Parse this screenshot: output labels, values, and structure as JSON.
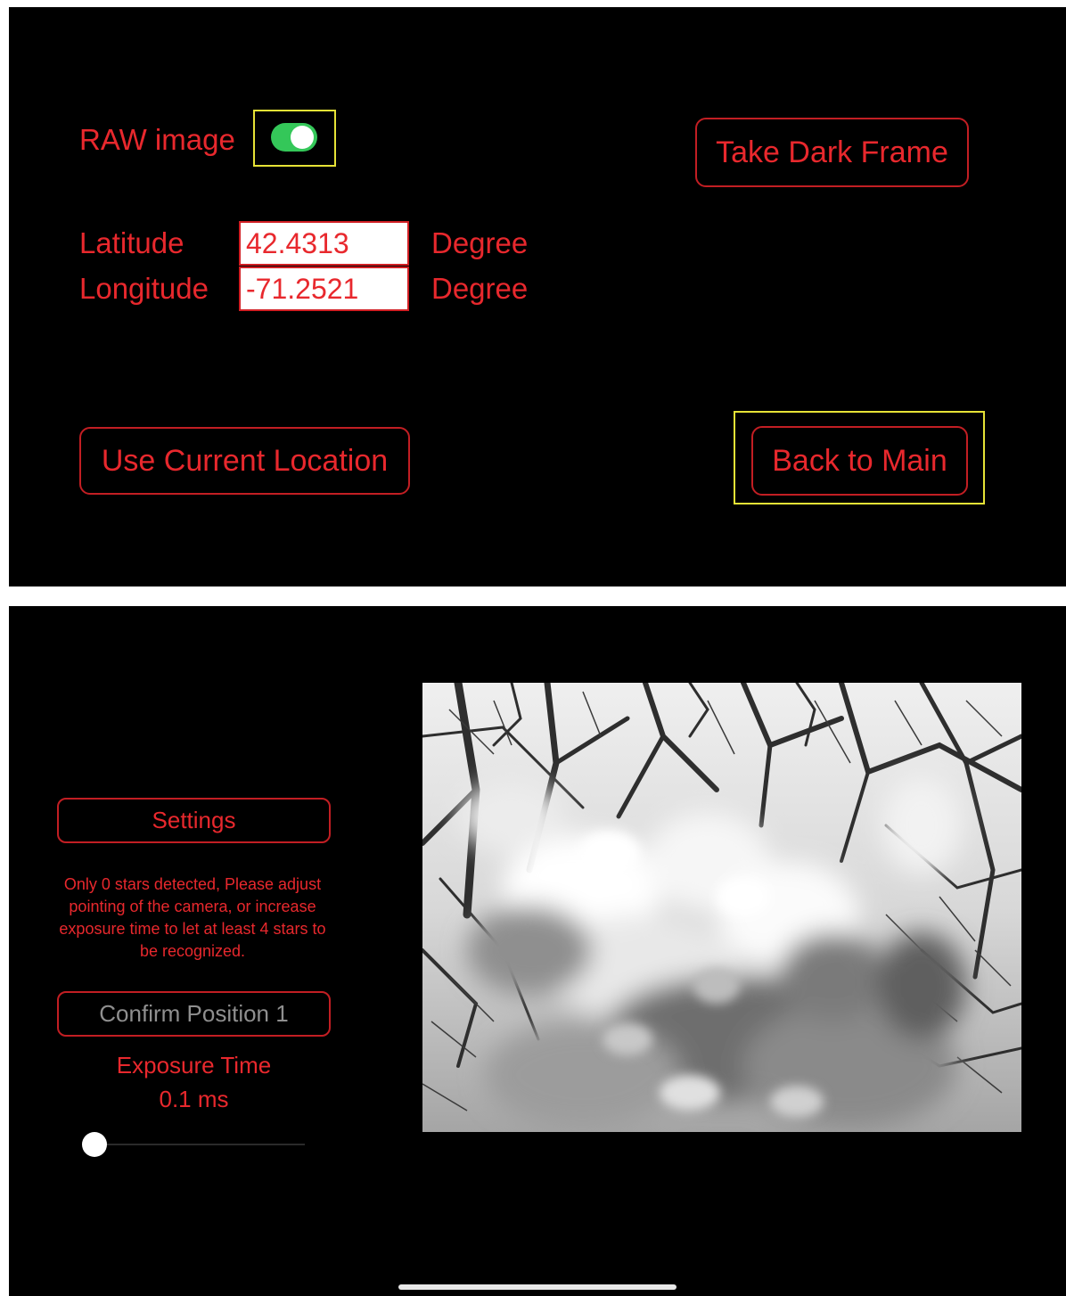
{
  "settings_screen": {
    "raw_image_label": "RAW image",
    "raw_image_enabled": true,
    "take_dark_frame_label": "Take Dark Frame",
    "latitude_label": "Latitude",
    "latitude_value": "42.4313",
    "latitude_unit": "Degree",
    "longitude_label": "Longitude",
    "longitude_value": "-71.2521",
    "longitude_unit": "Degree",
    "use_current_location_label": "Use Current Location",
    "back_to_main_label": "Back to Main"
  },
  "main_screen": {
    "settings_label": "Settings",
    "status_message": "Only 0  stars detected, Please adjust pointing of the camera, or increase exposure time to let at least 4 stars to be recognized.",
    "confirm_position_label": "Confirm Position 1",
    "exposure_time_label": "Exposure Time",
    "exposure_time_value": "0.1 ms",
    "exposure_slider_fraction": 0.0
  },
  "colors": {
    "accent_red": "#e8282d",
    "highlight_yellow": "#e6e236",
    "toggle_green": "#34c759",
    "background": "#000000"
  }
}
